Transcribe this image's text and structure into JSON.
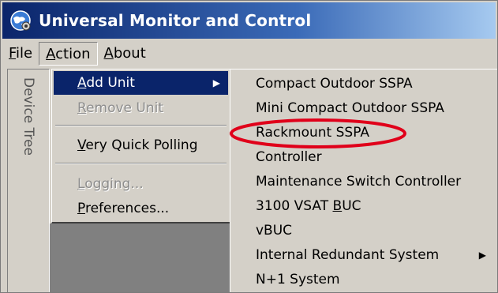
{
  "window": {
    "title": "Universal Monitor and Control"
  },
  "menubar": {
    "items": [
      {
        "label": "File"
      },
      {
        "label": "Action"
      },
      {
        "label": "About"
      }
    ]
  },
  "sidepanel": {
    "label": "Device Tree"
  },
  "action_menu": {
    "items": [
      {
        "label": "Add Unit",
        "state": "highlighted",
        "has_submenu": true
      },
      {
        "label": "Remove Unit",
        "state": "disabled"
      },
      {
        "label": "Very Quick Polling",
        "state": "enabled"
      },
      {
        "label": "Logging...",
        "state": "disabled"
      },
      {
        "label": "Preferences...",
        "state": "enabled"
      }
    ],
    "submenu_arrow": "▶"
  },
  "submenu": {
    "items": [
      {
        "label": "Compact Outdoor SSPA"
      },
      {
        "label": "Mini Compact Outdoor SSPA"
      },
      {
        "label": "Rackmount SSPA",
        "annotated": true
      },
      {
        "label": "Controller"
      },
      {
        "label": "Maintenance Switch Controller"
      },
      {
        "label_prefix": "3100 VSAT ",
        "label_underlined": "B",
        "label_suffix": "UC"
      },
      {
        "label": "vBUC"
      },
      {
        "label": "Internal Redundant System",
        "has_submenu": true
      },
      {
        "label": "N+1 System"
      }
    ],
    "submenu_arrow": "▶"
  },
  "colors": {
    "titlebar_start": "#0a246a",
    "titlebar_end": "#a6caf0",
    "highlight_bg": "#0a246a",
    "annotation_oval": "#e0001a",
    "face": "#d4d0c8"
  },
  "icons": {
    "title_icon": "globe-gear-icon",
    "submenu_arrow": "triangle-right-icon"
  }
}
